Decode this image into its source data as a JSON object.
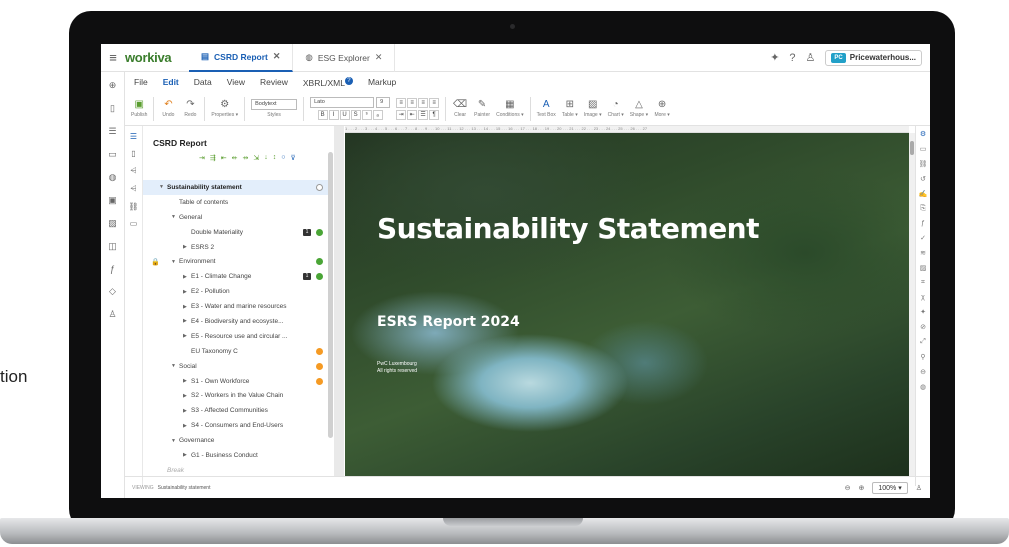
{
  "side_caption": "tion",
  "topbar": {
    "logo": "workiva",
    "tabs": [
      {
        "label": "CSRD Report",
        "active": true
      },
      {
        "label": "ESG Explorer",
        "active": false
      }
    ],
    "org_initials": "PC",
    "org_name": "Pricewaterhous..."
  },
  "menu": [
    "File",
    "Edit",
    "Data",
    "View",
    "Review",
    "XBRL/XML",
    "Markup"
  ],
  "menu_badge": "?",
  "toolbar": {
    "publish": "Publish",
    "undo": "Undo",
    "redo": "Redo",
    "properties": "Properties ▾",
    "style_select": "Bodytext",
    "styles": "Styles",
    "font_select": "Lato",
    "size_select": "9",
    "clear": "Clear",
    "painter": "Painter",
    "conditions": "Conditions ▾",
    "textbox": "Text Box",
    "table": "Table ▾",
    "image": "Image ▾",
    "chart": "Chart ▾",
    "shape": "Shape ▾",
    "more": "More ▾"
  },
  "outline": {
    "title": "CSRD Report",
    "items": [
      {
        "label": "Sustainability statement",
        "level": 0,
        "arrow": "▼",
        "status": "empty",
        "selected": true,
        "bold": true
      },
      {
        "label": "Table of contents",
        "level": 1,
        "arrow": ""
      },
      {
        "label": "General",
        "level": 1,
        "arrow": "▼"
      },
      {
        "label": "Double Materiality",
        "level": 2,
        "arrow": "",
        "status": "green",
        "comment": true
      },
      {
        "label": "ESRS 2",
        "level": 2,
        "arrow": "▶"
      },
      {
        "label": "Environment",
        "level": 1,
        "arrow": "▼",
        "status": "green",
        "locked": true
      },
      {
        "label": "E1 - Climate Change",
        "level": 2,
        "arrow": "▶",
        "status": "green",
        "comment": true
      },
      {
        "label": "E2 - Pollution",
        "level": 2,
        "arrow": "▶"
      },
      {
        "label": "E3 - Water and marine resources",
        "level": 2,
        "arrow": "▶"
      },
      {
        "label": "E4 - Biodiversity and ecosyste...",
        "level": 2,
        "arrow": "▶"
      },
      {
        "label": "E5 - Resource use and circular ...",
        "level": 2,
        "arrow": "▶"
      },
      {
        "label": "EU Taxonomy C",
        "level": 2,
        "arrow": "",
        "status": "orange"
      },
      {
        "label": "Social",
        "level": 1,
        "arrow": "▼",
        "status": "orange"
      },
      {
        "label": "S1 - Own Workforce",
        "level": 2,
        "arrow": "▶",
        "status": "orange"
      },
      {
        "label": "S2 - Workers in the Value Chain",
        "level": 2,
        "arrow": "▶"
      },
      {
        "label": "S3 - Affected Communities",
        "level": 2,
        "arrow": "▶"
      },
      {
        "label": "S4 - Consumers and End-Users",
        "level": 2,
        "arrow": "▶"
      },
      {
        "label": "Governance",
        "level": 1,
        "arrow": "▼"
      },
      {
        "label": "G1 - Business Conduct",
        "level": 2,
        "arrow": "▶"
      },
      {
        "label": "Break",
        "level": 0,
        "arrow": "",
        "break": true
      }
    ]
  },
  "ruler": "1 . . . 2 . . . 3 . . . 4 . . . 5 . . . 6 . . . 7 . . . 8 . . . 9 . . . 10 . . . 11 . . . 12 . . . 13 . . . 14 . . . 15 . . . 16 . . . 17 . . . 18 . . . 19 . . . 20 . . . 21 . . . 22 . . . 23 . . . 24 . . . 25 . . . 26 . . . 27",
  "document": {
    "title": "Sustainability Statement",
    "subtitle": "ESRS Report 2024",
    "company": "PwC Luxembourg",
    "rights": "All rights reserved"
  },
  "status": {
    "viewing_label": "Viewing",
    "viewing_value": "Sustainability statement",
    "zoom": "100%"
  }
}
